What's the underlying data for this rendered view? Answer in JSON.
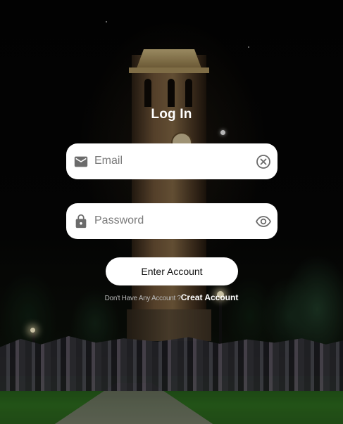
{
  "login": {
    "title": "Log In",
    "email": {
      "placeholder": "Email",
      "value": "",
      "icon": "mail-icon",
      "trailing_icon": "clear-circle-icon"
    },
    "password": {
      "placeholder": "Password",
      "value": "",
      "icon": "lock-icon",
      "trailing_icon": "eye-icon"
    },
    "submit_label": "Enter Account",
    "signup_prompt": "Don't Have Any Account ?",
    "signup_link": "Creat Account"
  },
  "colors": {
    "field_background": "#ffffff",
    "icon_gray": "#6b6b6b",
    "title_text": "#ffffff",
    "prompt_text": "#b9b9b9"
  }
}
